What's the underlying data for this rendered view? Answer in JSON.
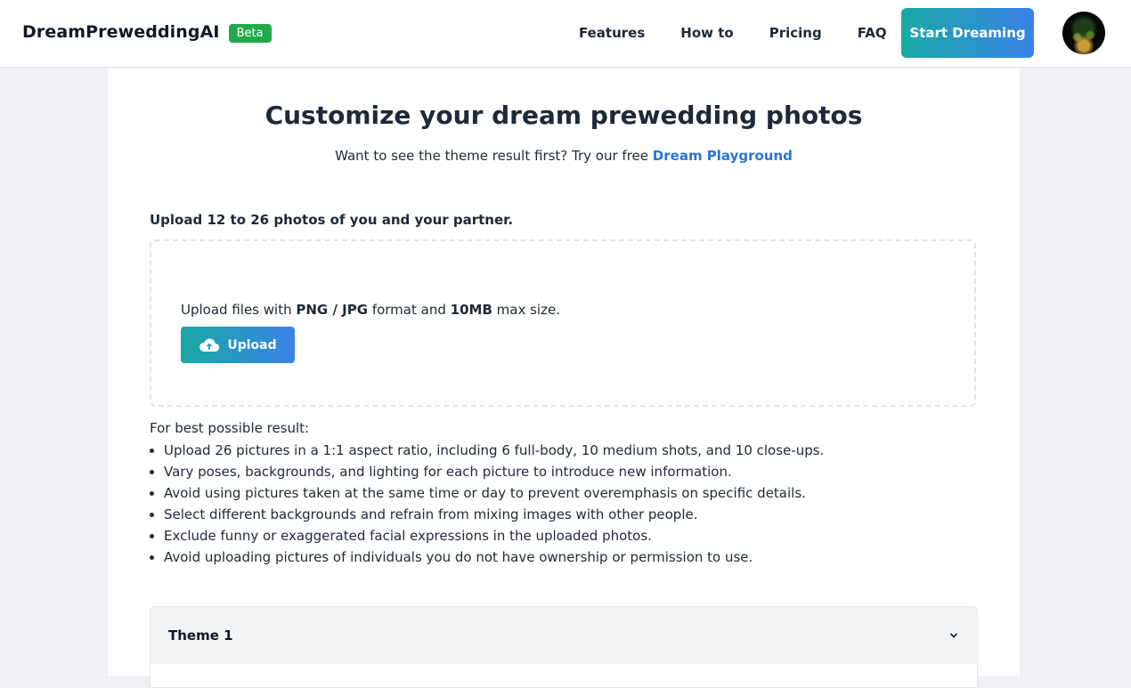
{
  "nav": {
    "brand": "DreamPreweddingAI",
    "badge": "Beta",
    "links": [
      "Features",
      "How to",
      "Pricing",
      "FAQ"
    ],
    "cta": "Start Dreaming"
  },
  "main": {
    "title": "Customize your dream prewedding photos",
    "subtitle_text": "Want to see the theme result first? Try our free",
    "subtitle_link": "Dream Playground",
    "upload_label": "Upload 12 to 26 photos of you and your partner.",
    "dropzone": {
      "text_prefix": "Upload files with",
      "format": "PNG / JPG",
      "text_mid": "format and",
      "size": "10MB",
      "text_suffix": "max size.",
      "button": "Upload"
    },
    "tips_heading": "For best possible result:",
    "tips": [
      "Upload 26 pictures in a 1:1 aspect ratio, including 6 full-body, 10 medium shots, and 10 close-ups.",
      "Vary poses, backgrounds, and lighting for each picture to introduce new information.",
      "Avoid using pictures taken at the same time or day to prevent overemphasis on specific details.",
      "Select different backgrounds and refrain from mixing images with other people.",
      "Exclude funny or exaggerated facial expressions in the uploaded photos.",
      "Avoid uploading pictures of individuals you do not have ownership or permission to use."
    ],
    "accordion_title": "Theme 1"
  },
  "colors": {
    "accent_start": "#17a9a4",
    "accent_end": "#3b82e6",
    "link": "#2b74d9",
    "beta": "#22a84a"
  }
}
